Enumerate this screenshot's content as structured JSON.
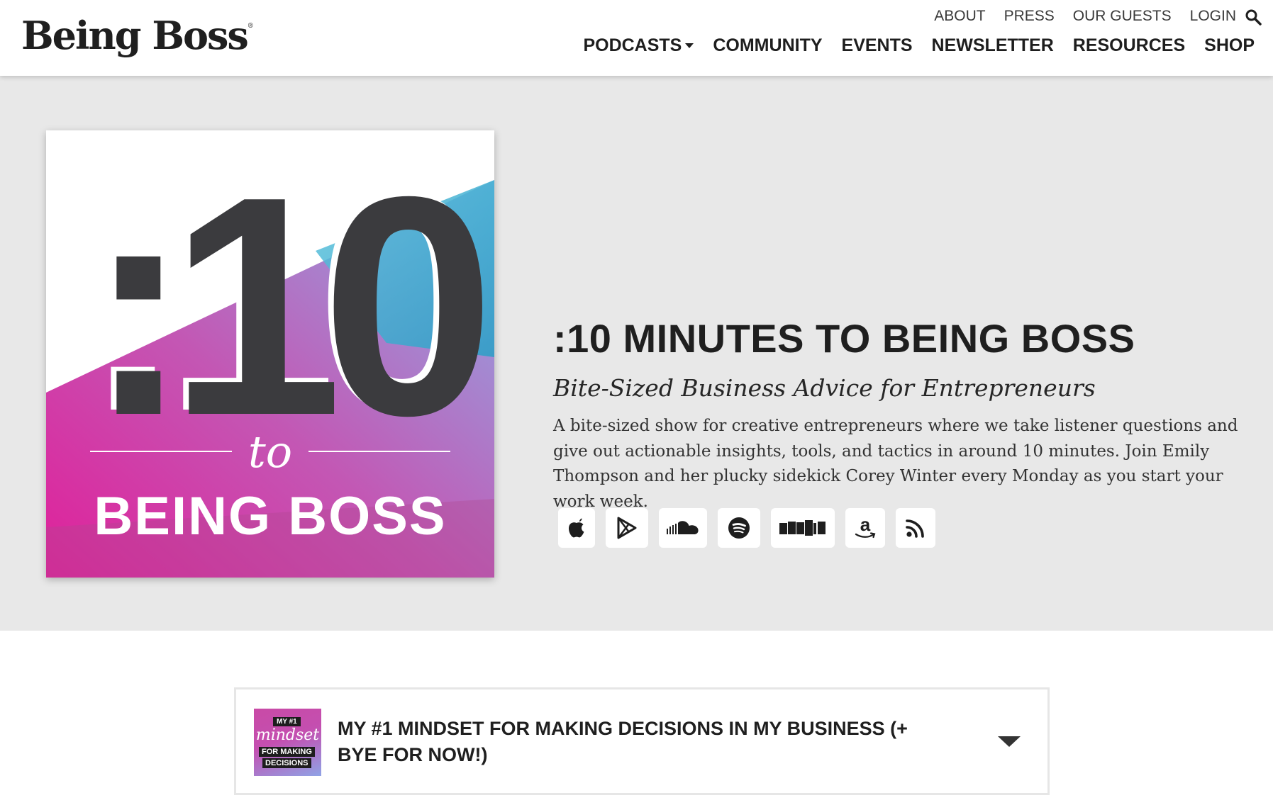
{
  "header": {
    "logo": "Being Boss",
    "logo_mark": "®",
    "utility_nav": [
      "ABOUT",
      "PRESS",
      "OUR GUESTS",
      "LOGIN"
    ],
    "main_nav": [
      "PODCASTS",
      "COMMUNITY",
      "EVENTS",
      "NEWSLETTER",
      "RESOURCES",
      "SHOP"
    ]
  },
  "hero": {
    "artwork": {
      "number": ":10",
      "to": "to",
      "brand": "BEING BOSS"
    },
    "title": ":10 MINUTES TO BEING BOSS",
    "subtitle": "Bite-Sized Business Advice for Entrepreneurs",
    "description": "A bite-sized show for creative entrepreneurs where we take listener questions and give out actionable insights, tools, and tactics in around 10 minutes. Join Emily Thompson and her plucky sidekick Corey Winter every Monday as you start your work week.",
    "platforms": [
      "apple-podcasts-icon",
      "google-play-icon",
      "soundcloud-icon",
      "spotify-icon",
      "stitcher-icon",
      "amazon-icon",
      "rss-icon"
    ]
  },
  "episode": {
    "thumb": {
      "line1": "MY #1",
      "line2": "mindset",
      "line3": "FOR MAKING",
      "line4": "DECISIONS"
    },
    "title": "MY #1 MINDSET FOR MAKING DECISIONS IN MY BUSINESS (+ BYE FOR NOW!)"
  },
  "colors": {
    "hero_bg": "#e8e8e8",
    "art_magenta": "#e0209a",
    "art_teal": "#2fb3d3",
    "art_dark": "#3b3b3e"
  }
}
